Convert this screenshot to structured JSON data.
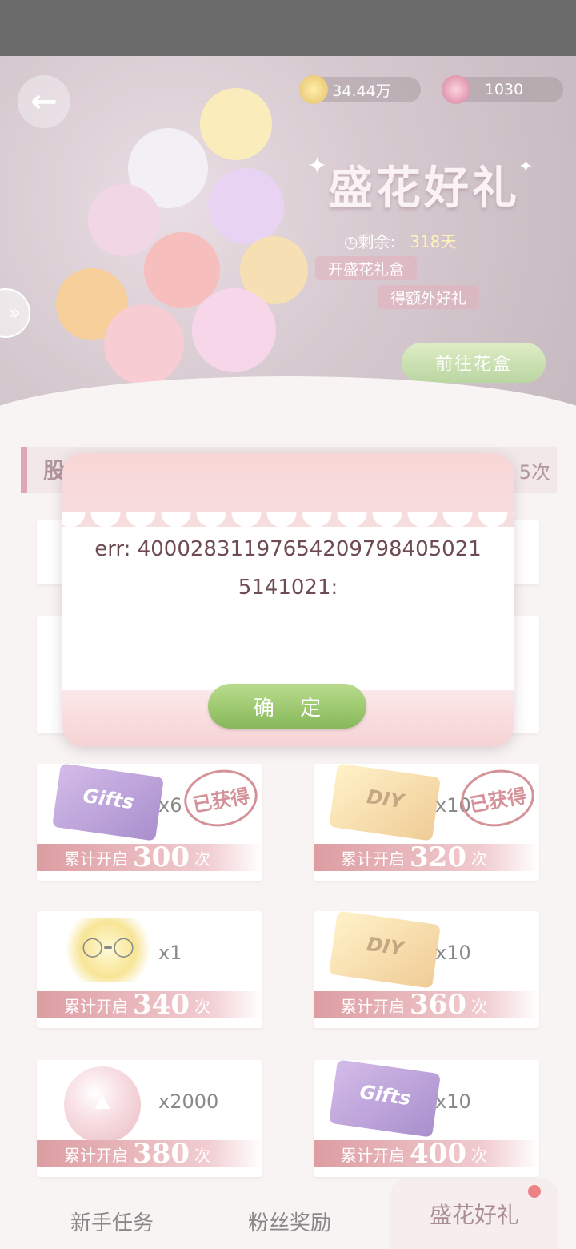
{
  "header": {
    "coins": "34.44万",
    "gems": "1030",
    "event_title": "盛花好礼",
    "remain_label": "剩余:",
    "remain_days": "318天",
    "promo_line1": "开盛花礼盒",
    "promo_line2": "得额外好礼",
    "goto_button": "前往花盒"
  },
  "list_header": {
    "title": "股",
    "count": "5次"
  },
  "rewards": [
    {
      "qty": "x6",
      "prefix": "累计开启",
      "count": "300",
      "suffix": "次",
      "stamp": "已获得",
      "item": "Gifts"
    },
    {
      "qty": "x10",
      "prefix": "累计开启",
      "count": "320",
      "suffix": "次",
      "stamp": "已获得",
      "item": "DIY"
    },
    {
      "qty": "x1",
      "prefix": "累计开启",
      "count": "340",
      "suffix": "次"
    },
    {
      "qty": "x10",
      "prefix": "累计开启",
      "count": "360",
      "suffix": "次",
      "item": "DIY"
    },
    {
      "qty": "x2000",
      "prefix": "累计开启",
      "count": "380",
      "suffix": "次"
    },
    {
      "qty": "x10",
      "prefix": "累计开启",
      "count": "400",
      "suffix": "次",
      "item": "Gifts"
    }
  ],
  "tabs": [
    {
      "label": "新手任务"
    },
    {
      "label": "粉丝奖励"
    },
    {
      "label": "盛花好礼"
    }
  ],
  "dialog": {
    "message": "err: 40002831197654209798405021 5141021:",
    "ok_label": "确 定"
  },
  "colors": {
    "accent": "#c4565f",
    "confirm_green": "#8ab85f",
    "dialog_pink": "#f9d6d6"
  }
}
